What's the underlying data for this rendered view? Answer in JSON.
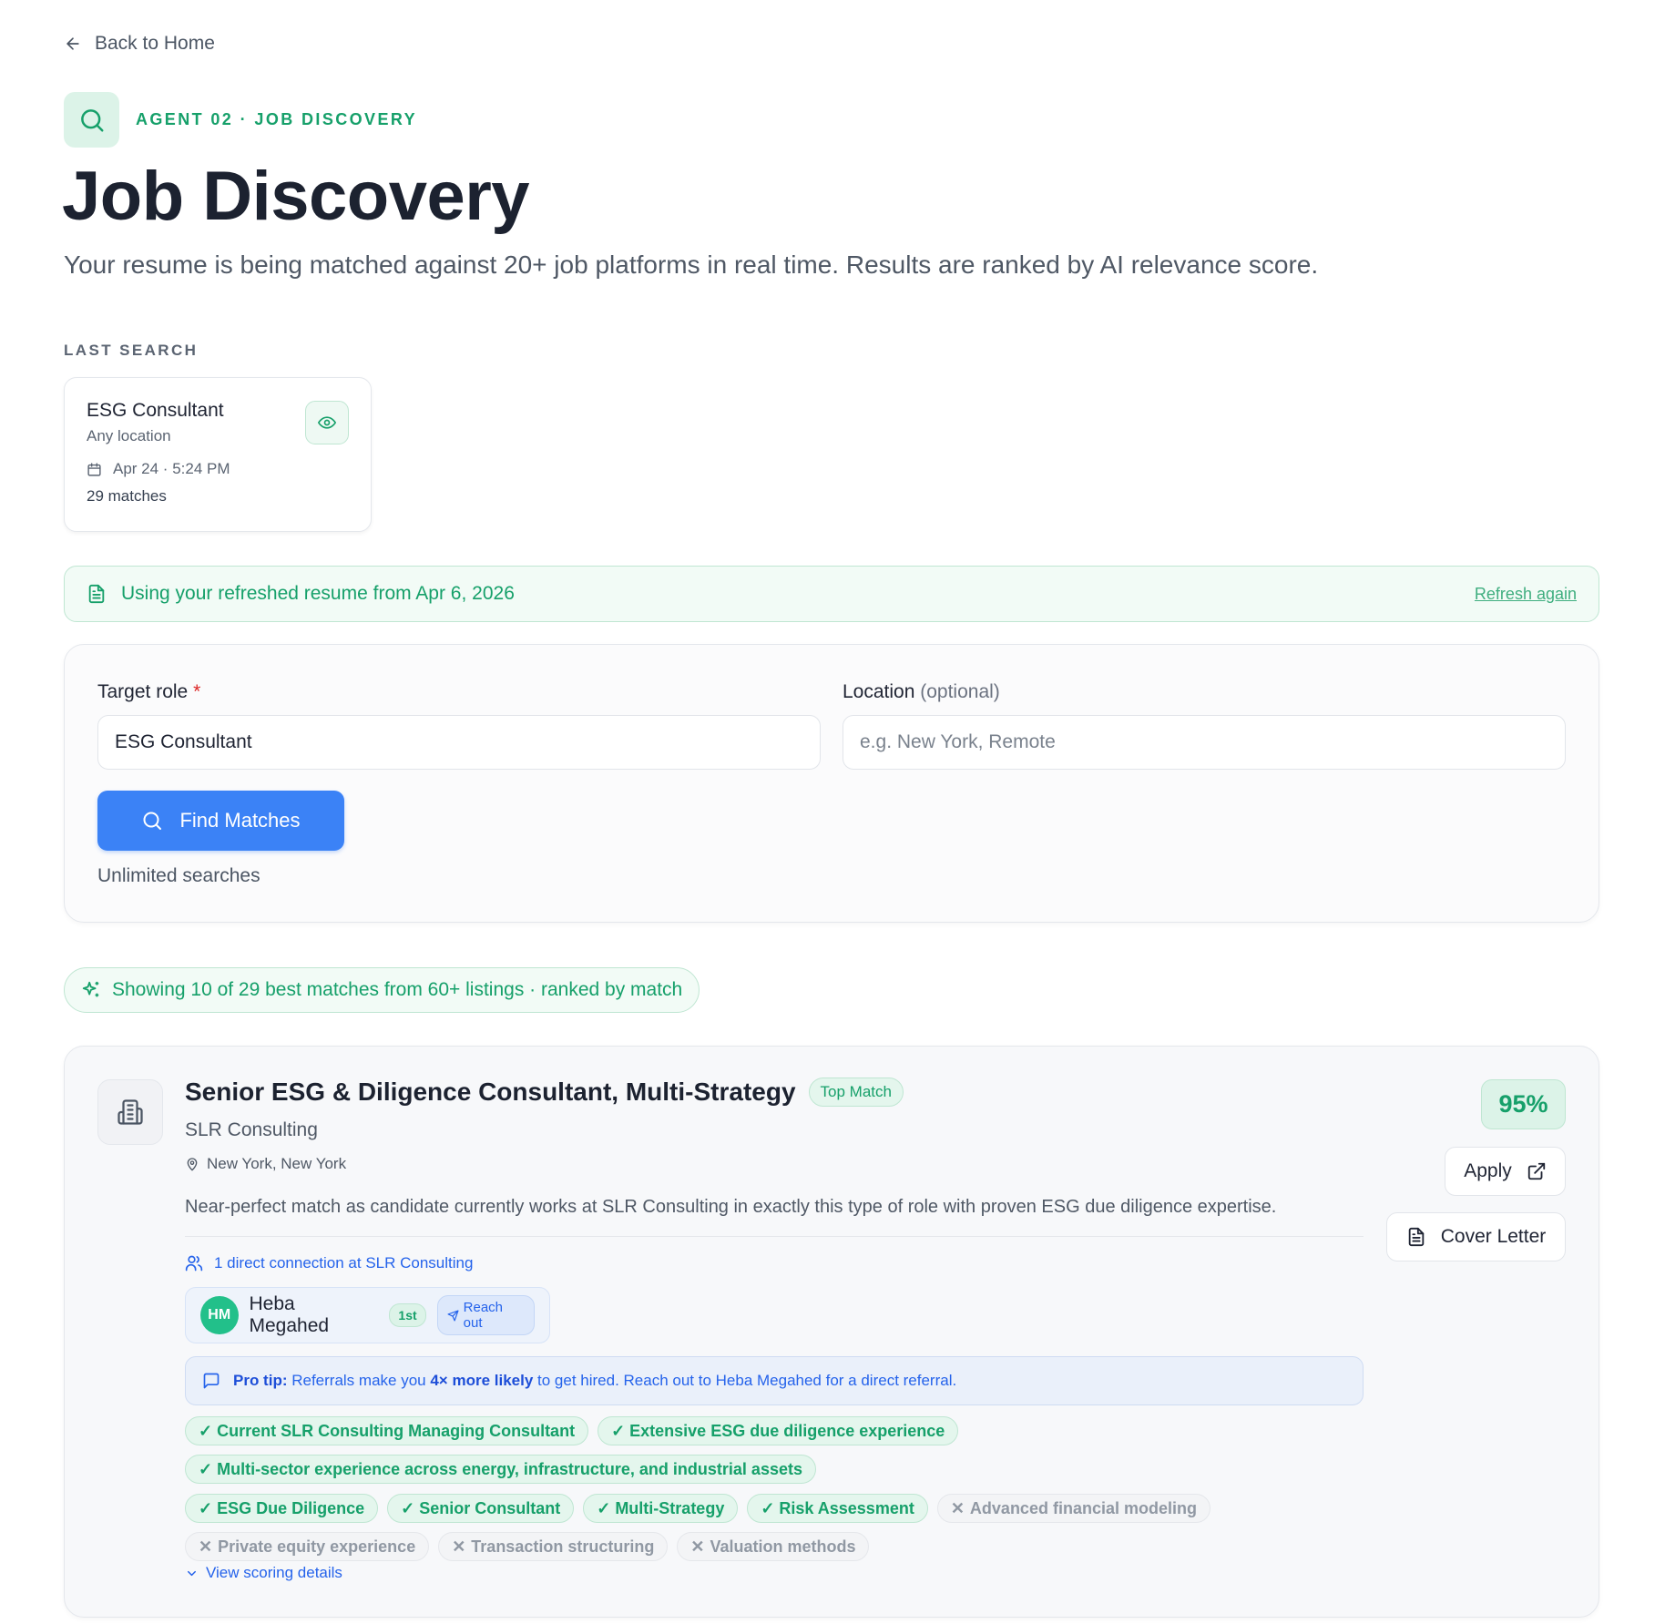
{
  "nav": {
    "back_label": "Back to Home"
  },
  "header": {
    "kicker": "AGENT 02 · JOB DISCOVERY",
    "title": "Job Discovery",
    "subtitle": "Your resume is being matched against 20+ job platforms in real time. Results are ranked by AI relevance score."
  },
  "last_search": {
    "section_label": "LAST SEARCH",
    "role": "ESG Consultant",
    "location": "Any location",
    "datetime": "Apr 24 · 5:24 PM",
    "matches": "29 matches"
  },
  "resume_banner": {
    "text": "Using your refreshed resume from Apr 6, 2026",
    "link": "Refresh again"
  },
  "form": {
    "role_label": "Target role",
    "role_required": "*",
    "role_value": "ESG Consultant",
    "location_label": "Location",
    "location_optional": "(optional)",
    "location_placeholder": "e.g. New York, Remote",
    "submit_label": "Find Matches",
    "quota_text": "Unlimited searches"
  },
  "results": {
    "summary": "Showing 10 of 29 best matches from 60+ listings · ranked by match"
  },
  "job": {
    "title": "Senior ESG & Diligence Consultant, Multi-Strategy",
    "badge": "Top Match",
    "company": "SLR Consulting",
    "location": "New York, New York",
    "summary": "Near-perfect match as candidate currently works at SLR Consulting in exactly this type of role with proven ESG due diligence expertise.",
    "score": "95%",
    "apply_label": "Apply",
    "cover_letter_label": "Cover Letter",
    "connections_text": "1 direct connection at SLR Consulting",
    "contact": {
      "initials": "HM",
      "name": "Heba Megahed",
      "degree": "1st",
      "action": "Reach out"
    },
    "protip": {
      "lead": "Pro tip:",
      "text1": " Referrals make you ",
      "emphasis": "4× more likely",
      "text2": " to get hired. Reach out to Heba Megahed for a direct referral."
    },
    "highlights_row1": [
      "✓ Current SLR Consulting Managing Consultant",
      "✓ Extensive ESG due diligence experience"
    ],
    "highlights_row2": [
      "✓ Multi-sector experience across energy, infrastructure, and industrial assets"
    ],
    "skills_matched": [
      "✓ ESG Due Diligence",
      "✓ Senior Consultant",
      "✓ Multi-Strategy",
      "✓ Risk Assessment"
    ],
    "skills_missing_row1": [
      "Advanced financial modeling"
    ],
    "skills_missing_row2": [
      "Private equity experience",
      "Transaction structuring",
      "Valuation methods"
    ],
    "scoring_link": "View scoring details"
  },
  "icons": {
    "back": "arrow-left-icon",
    "agent": "search-icon",
    "eye": "eye-icon",
    "calendar": "calendar-icon",
    "document": "file-text-icon",
    "sparkle": "sparkles-icon",
    "building": "building-icon",
    "pin": "map-pin-icon",
    "users": "users-icon",
    "send": "send-icon",
    "chat": "message-square-icon",
    "external": "external-link-icon",
    "chevron": "chevron-down-icon",
    "x": "x-icon"
  },
  "colors": {
    "accent_green": "#16a06a",
    "primary_blue": "#3b82f6",
    "link_blue": "#2563eb",
    "title": "#1c2230"
  }
}
